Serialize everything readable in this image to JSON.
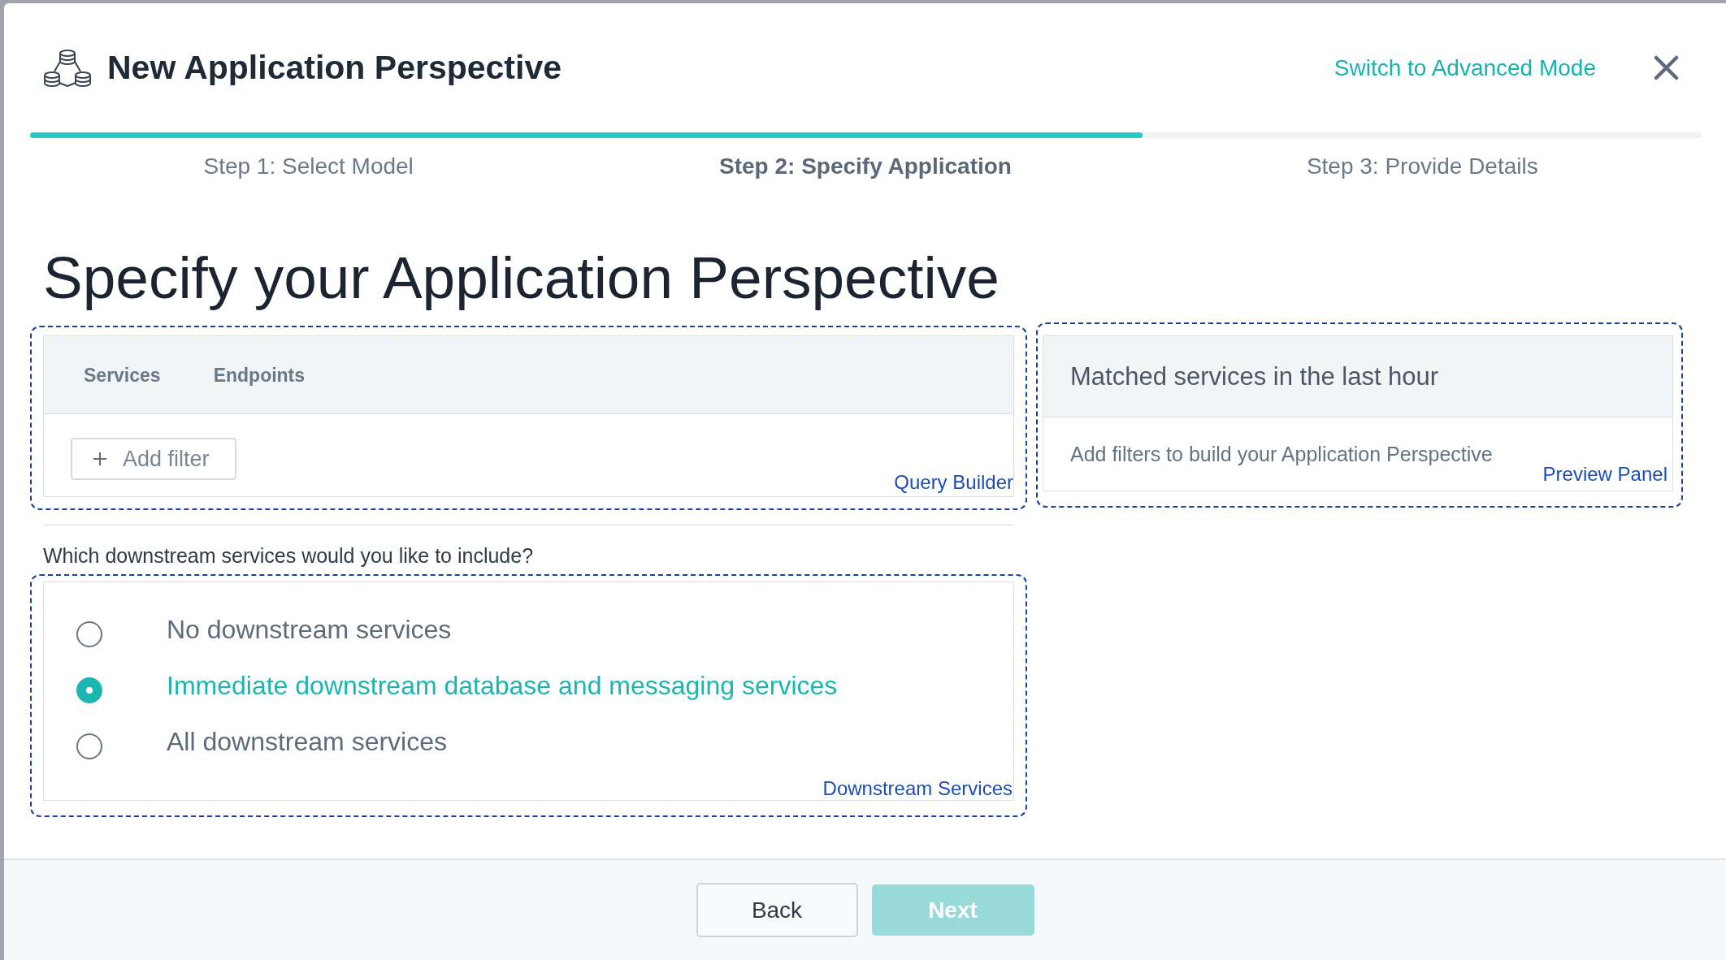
{
  "dialog": {
    "title": "New Application Perspective",
    "mode_link": "Switch to Advanced Mode"
  },
  "progress": {
    "level": 0.666
  },
  "steps": [
    {
      "label": "Step 1: Select Model",
      "selected": false
    },
    {
      "label": "Step 2: Specify Application",
      "selected": true
    },
    {
      "label": "Step 3: Provide Details",
      "selected": false
    }
  ],
  "heading": "Specify your Application Perspective",
  "query_builder": {
    "tabs": [
      {
        "label": "Services",
        "selected": false
      },
      {
        "label": "Endpoints",
        "selected": false
      }
    ],
    "add_filter": "Add filter",
    "annotation": "Query Builder"
  },
  "preview_panel": {
    "title": "Matched services in the last hour",
    "message": "Add filters to build your Application Perspective",
    "annotation": "Preview Panel"
  },
  "downstream": {
    "question": "Which downstream services would you like to include?",
    "options": [
      {
        "label": "No downstream services",
        "selected": false
      },
      {
        "label": "Immediate downstream database and messaging services",
        "selected": true
      },
      {
        "label": "All downstream services",
        "selected": false
      }
    ],
    "annotation": "Downstream Services"
  },
  "footer": {
    "buttons": [
      {
        "label": "Back",
        "kind": "secondary",
        "disabled": false
      },
      {
        "label": "Next",
        "kind": "primary",
        "disabled": true
      }
    ]
  }
}
